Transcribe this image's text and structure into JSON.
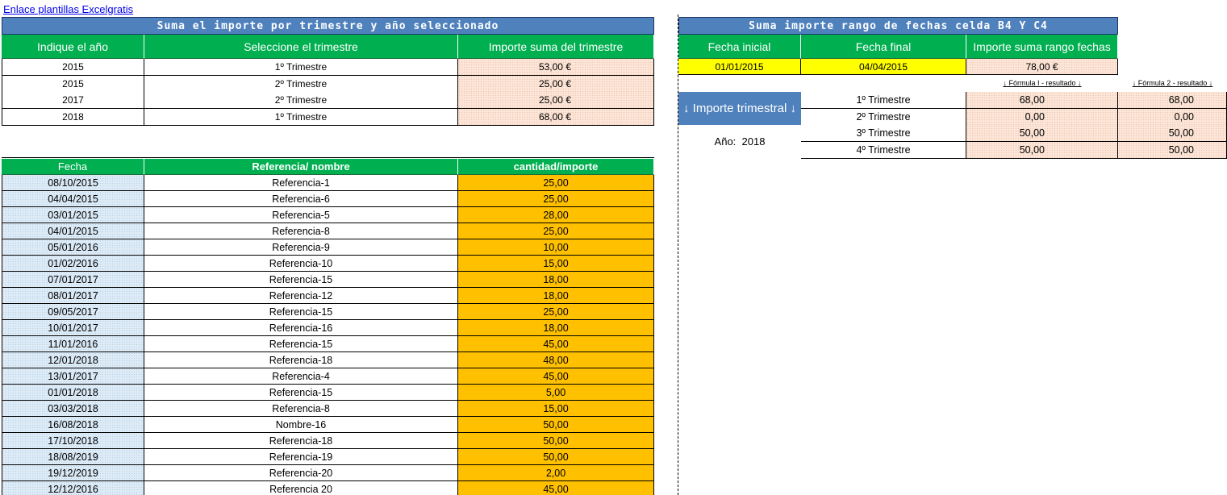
{
  "link": {
    "text": "Enlace plantillas Excelgratis"
  },
  "left_summary": {
    "title": "Suma el importe por trimestre y año seleccionado",
    "headers": [
      "Indique el año",
      "Seleccione el trimestre",
      "Importe  suma del trimestre"
    ],
    "rows": [
      [
        "2015",
        "1º Trimestre",
        "53,00 €"
      ],
      [
        "2015",
        "2º Trimestre",
        "25,00 €"
      ],
      [
        "2017",
        "2º Trimestre",
        "25,00 €"
      ],
      [
        "2018",
        "1º Trimestre",
        "68,00 €"
      ]
    ]
  },
  "right_summary": {
    "title": "Suma importe rango de fechas celda B4 Y C4",
    "headers": [
      "Fecha inicial",
      "Fecha final",
      "Importe suma rango fechas"
    ],
    "values": [
      "01/01/2015",
      "04/04/2015",
      "78,00 €"
    ],
    "formula1_label": "↓ Fórmula I - resultado ↓",
    "formula2_label": "↓ Fórmula 2 - resultado ↓",
    "box_label": "↓ Importe trimestral ↓",
    "year_label": "Año:",
    "year_value": "2018",
    "quarters": [
      [
        "1º Trimestre",
        "68,00",
        "68,00"
      ],
      [
        "2º Trimestre",
        "0,00",
        "0,00"
      ],
      [
        "3º Trimestre",
        "50,00",
        "50,00"
      ],
      [
        "4º Trimestre",
        "50,00",
        "50,00"
      ]
    ]
  },
  "data_table": {
    "headers": [
      "Fecha",
      "Referencia/ nombre",
      "cantidad/importe"
    ],
    "rows": [
      [
        "08/10/2015",
        "Referencia-1",
        "25,00"
      ],
      [
        "04/04/2015",
        "Referencia-6",
        "25,00"
      ],
      [
        "03/01/2015",
        "Referencia-5",
        "28,00"
      ],
      [
        "04/01/2015",
        "Referencia-8",
        "25,00"
      ],
      [
        "05/01/2016",
        "Referencia-9",
        "10,00"
      ],
      [
        "01/02/2016",
        "Referencia-10",
        "15,00"
      ],
      [
        "07/01/2017",
        "Referencia-15",
        "18,00"
      ],
      [
        "08/01/2017",
        "Referencia-12",
        "18,00"
      ],
      [
        "09/05/2017",
        "Referencia-15",
        "25,00"
      ],
      [
        "10/01/2017",
        "Referencia-16",
        "18,00"
      ],
      [
        "11/01/2016",
        "Referencia-15",
        "45,00"
      ],
      [
        "12/01/2018",
        "Referencia-18",
        "48,00"
      ],
      [
        "13/01/2017",
        "Referencia-4",
        "45,00"
      ],
      [
        "01/01/2018",
        "Referencia-15",
        "5,00"
      ],
      [
        "03/03/2018",
        "Referencia-8",
        "15,00"
      ],
      [
        "16/08/2018",
        "Nombre-16",
        "50,00"
      ],
      [
        "17/10/2018",
        "Referencia-18",
        "50,00"
      ],
      [
        "18/08/2019",
        "Referencia-19",
        "50,00"
      ],
      [
        "19/12/2019",
        "Referencia-20",
        "2,00"
      ],
      [
        "12/12/2016",
        "Referencia 20",
        "45,00"
      ]
    ]
  }
}
